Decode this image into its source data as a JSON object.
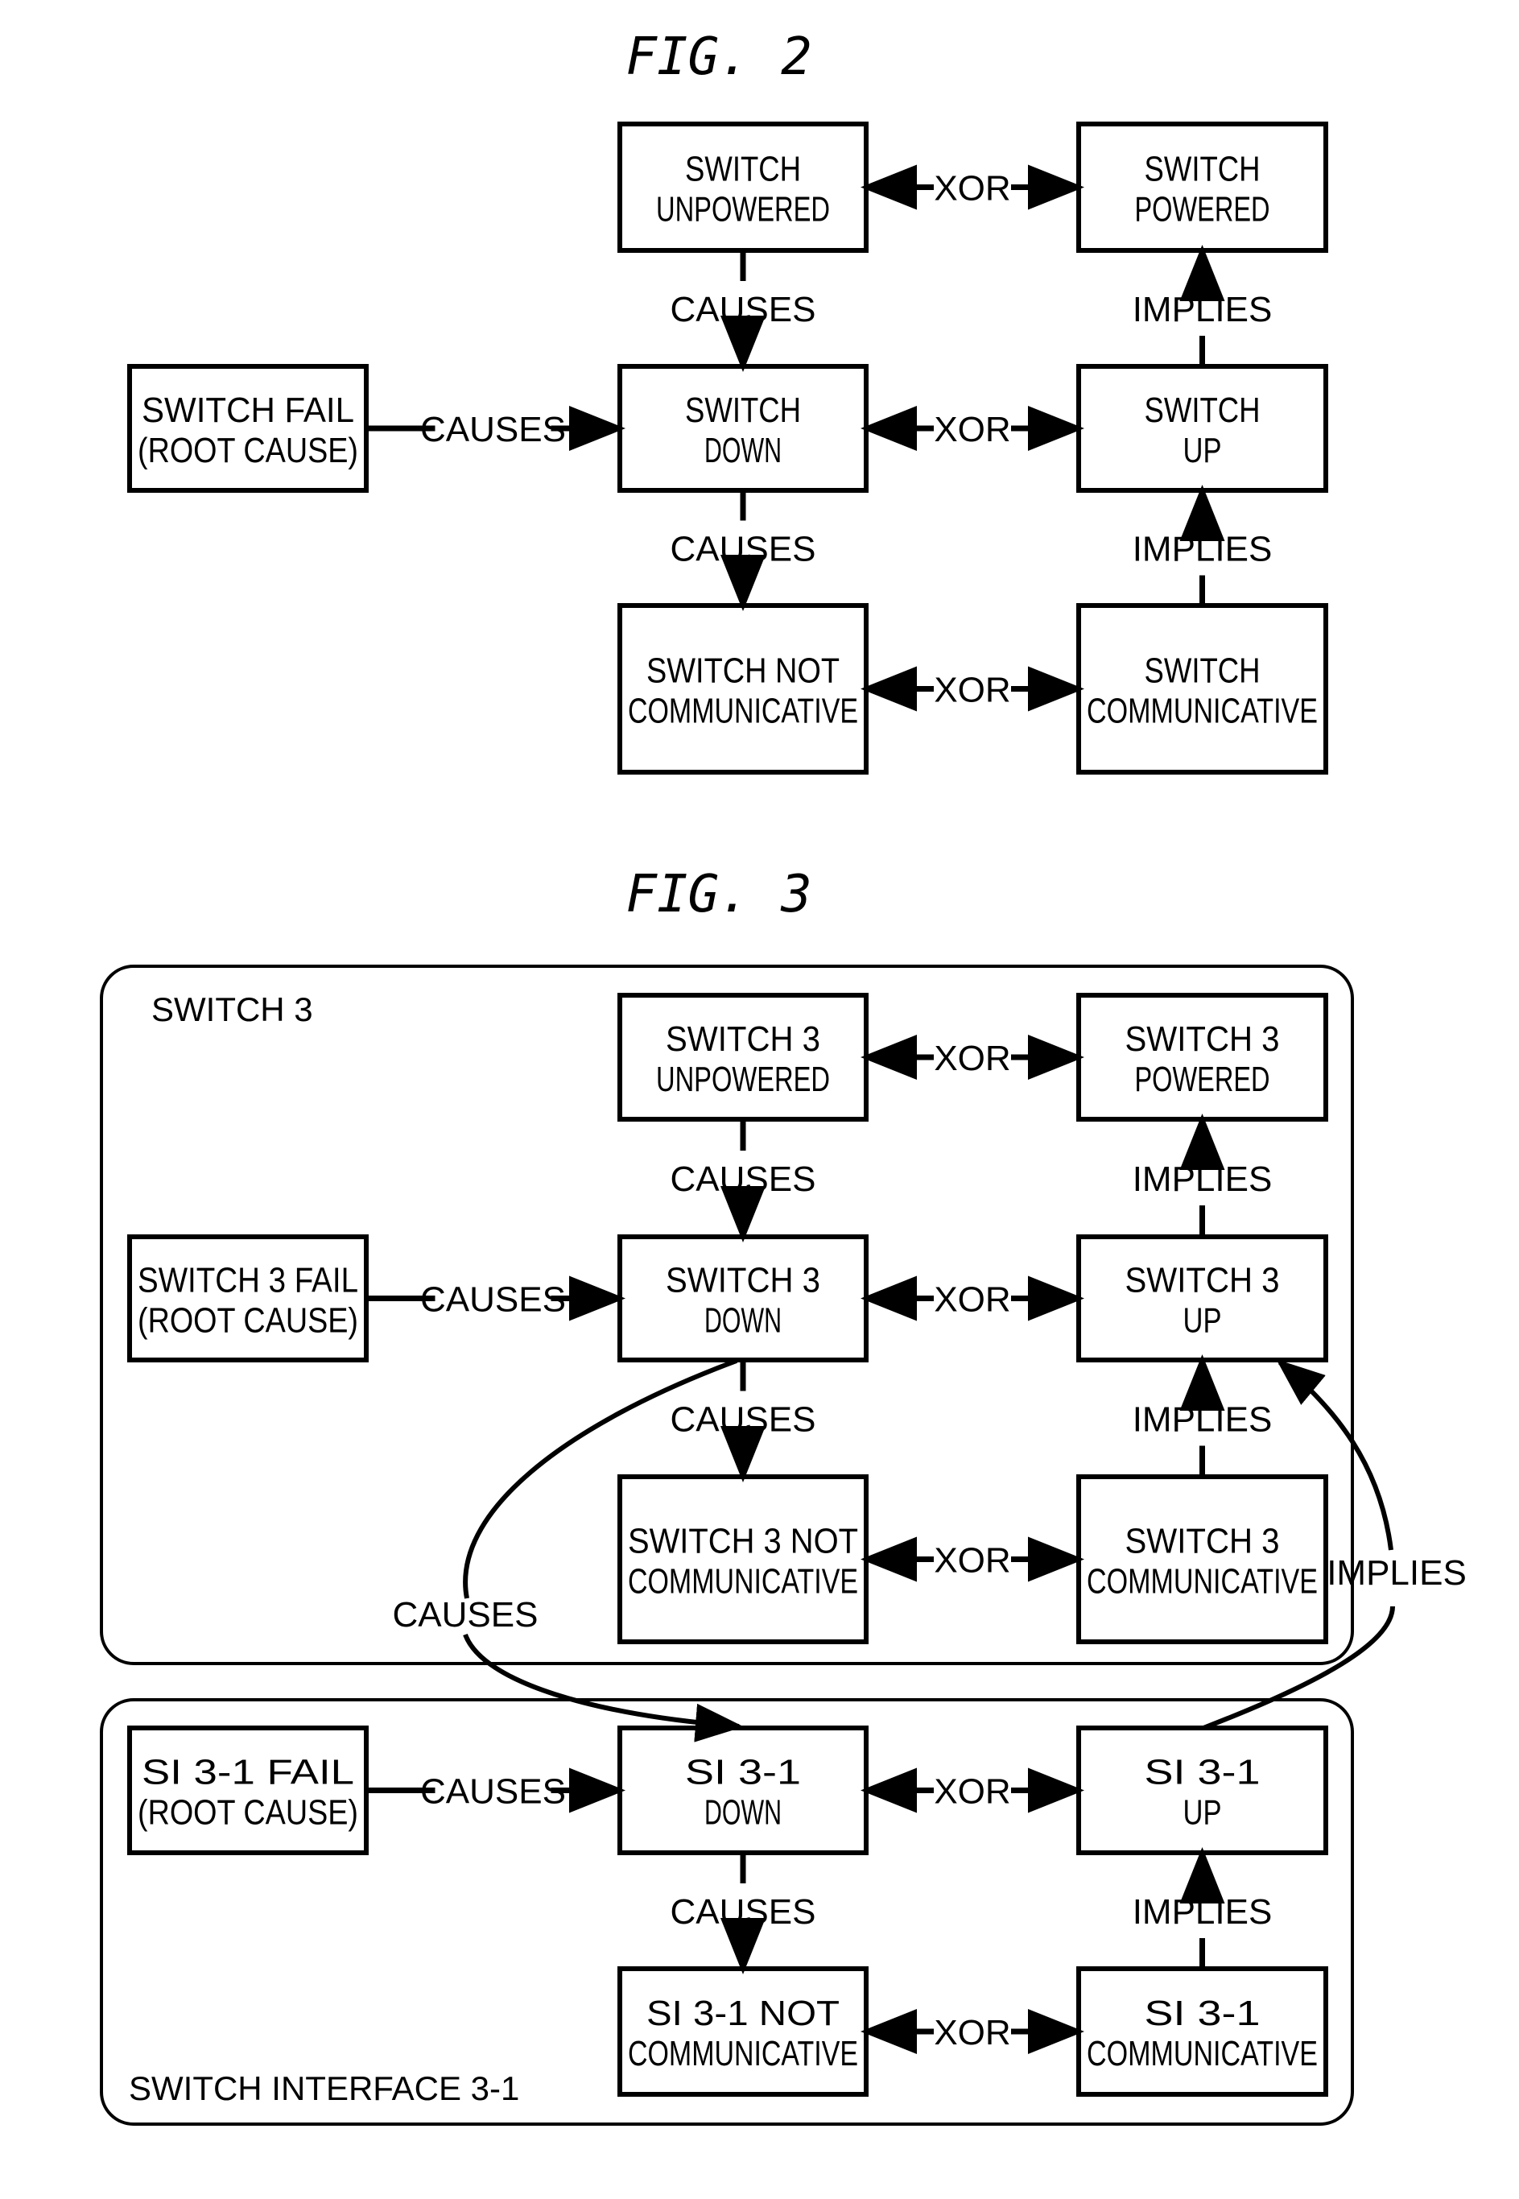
{
  "fig2": {
    "title": "FIG. 2",
    "nodes": {
      "fail": [
        "SWITCH FAIL",
        "(ROOT CAUSE)"
      ],
      "unpowered": [
        "SWITCH",
        "UNPOWERED"
      ],
      "powered": [
        "SWITCH",
        "POWERED"
      ],
      "down": [
        "SWITCH",
        "DOWN"
      ],
      "up": [
        "SWITCH",
        "UP"
      ],
      "notcomm": [
        "SWITCH NOT",
        "COMMUNICATIVE"
      ],
      "comm": [
        "SWITCH",
        "COMMUNICATIVE"
      ]
    }
  },
  "fig3": {
    "title": "FIG. 3",
    "switch_container": "SWITCH 3",
    "si_container": "SWITCH INTERFACE 3-1",
    "nodes": {
      "fail": [
        "SWITCH 3 FAIL",
        "(ROOT CAUSE)"
      ],
      "unpowered": [
        "SWITCH 3",
        "UNPOWERED"
      ],
      "powered": [
        "SWITCH 3",
        "POWERED"
      ],
      "down": [
        "SWITCH 3",
        "DOWN"
      ],
      "up": [
        "SWITCH 3",
        "UP"
      ],
      "notcomm": [
        "SWITCH 3 NOT",
        "COMMUNICATIVE"
      ],
      "comm": [
        "SWITCH 3",
        "COMMUNICATIVE"
      ],
      "si_fail": [
        "SI 3-1 FAIL",
        "(ROOT CAUSE)"
      ],
      "si_down": [
        "SI 3-1",
        "DOWN"
      ],
      "si_up": [
        "SI 3-1",
        "UP"
      ],
      "si_notcomm": [
        "SI 3-1 NOT",
        "COMMUNICATIVE"
      ],
      "si_comm": [
        "SI 3-1",
        "COMMUNICATIVE"
      ]
    }
  },
  "relations": {
    "causes": "CAUSES",
    "xor": "XOR",
    "implies": "IMPLIES"
  }
}
